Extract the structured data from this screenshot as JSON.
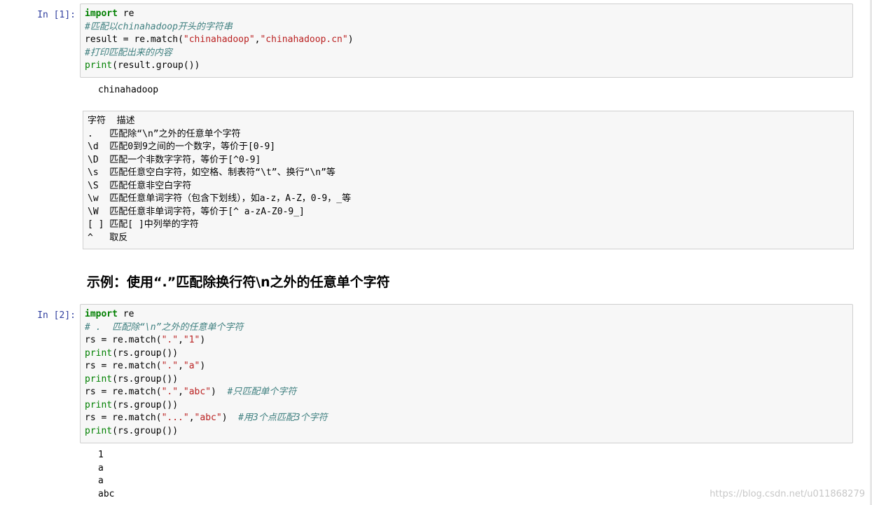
{
  "cell1": {
    "prompt": "In  [1]:",
    "lines": [
      [
        {
          "t": "import",
          "c": "kw"
        },
        {
          "t": " re",
          "c": "pn"
        }
      ],
      [
        {
          "t": "#匹配以chinahadoop开头的字符串",
          "c": "cm"
        }
      ],
      [
        {
          "t": "result ",
          "c": "pn"
        },
        {
          "t": "= ",
          "c": "pn"
        },
        {
          "t": "re.match(",
          "c": "pn"
        },
        {
          "t": "\"chinahadoop\"",
          "c": "str"
        },
        {
          "t": ",",
          "c": "pn"
        },
        {
          "t": "\"chinahadoop.cn\"",
          "c": "str"
        },
        {
          "t": ")",
          "c": "pn"
        }
      ],
      [
        {
          "t": "#打印匹配出来的内容",
          "c": "cm"
        }
      ],
      [
        {
          "t": "print",
          "c": "bi"
        },
        {
          "t": "(result.group())",
          "c": "pn"
        }
      ]
    ],
    "output": [
      "chinahadoop"
    ]
  },
  "table": {
    "lines": [
      "字符  描述",
      ".   匹配除“\\n”之外的任意单个字符",
      "\\d  匹配0到9之间的一个数字，等价于[0-9]",
      "\\D  匹配一个非数字字符，等价于[^0-9]",
      "\\s  匹配任意空白字符，如空格、制表符“\\t”、换行“\\n”等",
      "\\S  匹配任意非空白字符",
      "\\w  匹配任意单词字符（包含下划线），如a-z，A-Z，0-9，_等",
      "\\W  匹配任意非单词字符，等价于[^ a-zA-Z0-9_]",
      "[ ] 匹配[ ]中列举的字符",
      "^   取反"
    ]
  },
  "heading": "示例：使用“.”匹配除换行符\\n之外的任意单个字符",
  "cell2": {
    "prompt": "In  [2]:",
    "lines": [
      [
        {
          "t": "import",
          "c": "kw"
        },
        {
          "t": " re",
          "c": "pn"
        }
      ],
      [
        {
          "t": "# .  匹配除“\\n”之外的任意单个字符",
          "c": "cm"
        }
      ],
      [
        {
          "t": "rs ",
          "c": "pn"
        },
        {
          "t": "= re.match(",
          "c": "pn"
        },
        {
          "t": "\".\"",
          "c": "str"
        },
        {
          "t": ",",
          "c": "pn"
        },
        {
          "t": "\"1\"",
          "c": "str"
        },
        {
          "t": ")",
          "c": "pn"
        }
      ],
      [
        {
          "t": "print",
          "c": "bi"
        },
        {
          "t": "(rs.group())",
          "c": "pn"
        }
      ],
      [
        {
          "t": "rs ",
          "c": "pn"
        },
        {
          "t": "= re.match(",
          "c": "pn"
        },
        {
          "t": "\".\"",
          "c": "str"
        },
        {
          "t": ",",
          "c": "pn"
        },
        {
          "t": "\"a\"",
          "c": "str"
        },
        {
          "t": ")",
          "c": "pn"
        }
      ],
      [
        {
          "t": "print",
          "c": "bi"
        },
        {
          "t": "(rs.group())",
          "c": "pn"
        }
      ],
      [
        {
          "t": "rs ",
          "c": "pn"
        },
        {
          "t": "= re.match(",
          "c": "pn"
        },
        {
          "t": "\".\"",
          "c": "str"
        },
        {
          "t": ",",
          "c": "pn"
        },
        {
          "t": "\"abc\"",
          "c": "str"
        },
        {
          "t": ")  ",
          "c": "pn"
        },
        {
          "t": "#只匹配单个字符",
          "c": "cm"
        }
      ],
      [
        {
          "t": "print",
          "c": "bi"
        },
        {
          "t": "(rs.group())",
          "c": "pn"
        }
      ],
      [
        {
          "t": "rs ",
          "c": "pn"
        },
        {
          "t": "= re.match(",
          "c": "pn"
        },
        {
          "t": "\"...\"",
          "c": "str"
        },
        {
          "t": ",",
          "c": "pn"
        },
        {
          "t": "\"abc\"",
          "c": "str"
        },
        {
          "t": ")  ",
          "c": "pn"
        },
        {
          "t": "#用3个点匹配3个字符",
          "c": "cm"
        }
      ],
      [
        {
          "t": "print",
          "c": "bi"
        },
        {
          "t": "(rs.group())",
          "c": "pn"
        }
      ]
    ],
    "output": [
      "1",
      "a",
      "a",
      "abc"
    ]
  },
  "watermark": "https://blog.csdn.net/u011868279",
  "colors": {
    "keyword": "#008000",
    "string": "#ba2121",
    "comment": "#408080",
    "prompt": "#303f9f",
    "cell_bg": "#f7f7f7",
    "cell_border": "#cfcfcf"
  }
}
